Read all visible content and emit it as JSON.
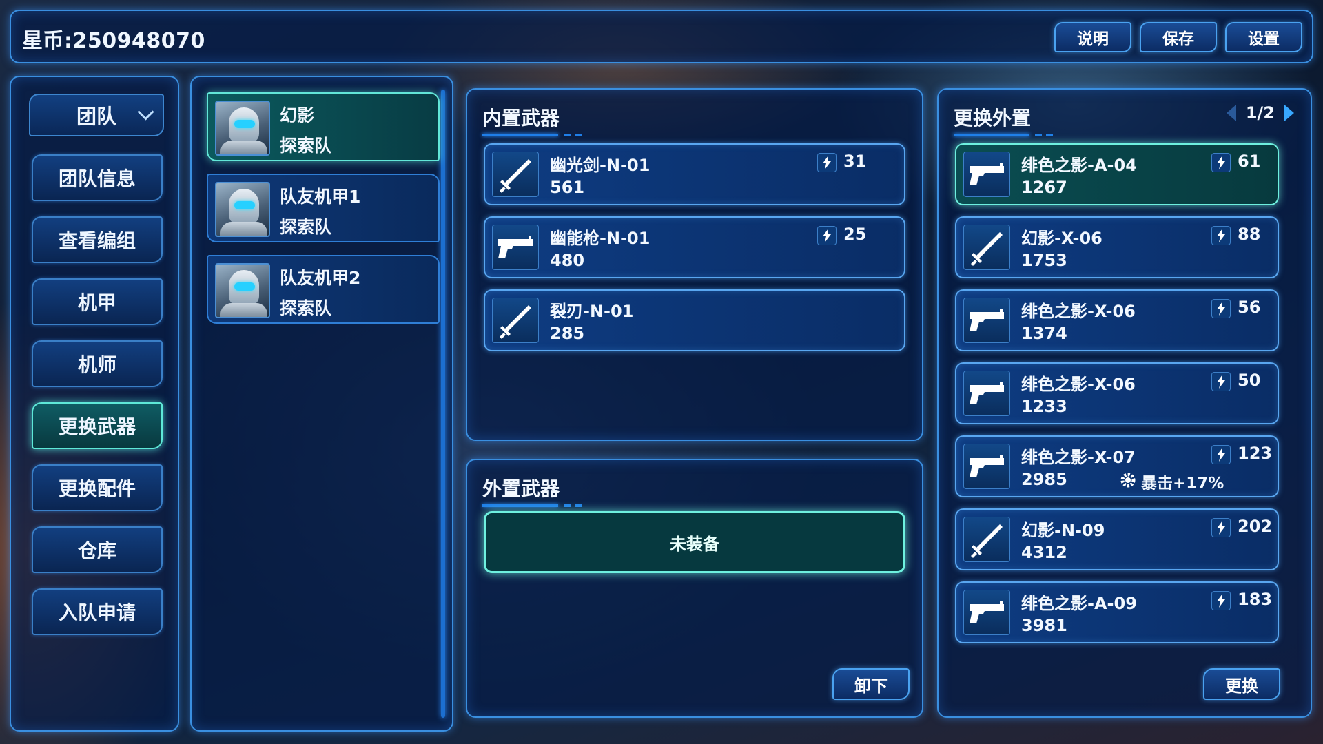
{
  "header": {
    "coins": "星币:250948070",
    "buttons": {
      "help": "说明",
      "save": "保存",
      "settings": "设置"
    }
  },
  "nav": {
    "dropdown": "团队",
    "items": [
      "团队信息",
      "查看编组",
      "机甲",
      "机师",
      "更换武器",
      "更换配件",
      "仓库",
      "入队申请"
    ],
    "active": "更换武器"
  },
  "team": {
    "members": [
      {
        "name": "幻影",
        "team": "探索队",
        "selected": true
      },
      {
        "name": "队友机甲1",
        "team": "探索队",
        "selected": false
      },
      {
        "name": "队友机甲2",
        "team": "探索队",
        "selected": false
      }
    ]
  },
  "internal": {
    "title": "内置武器",
    "weapons": [
      {
        "icon": "sword-icon",
        "name": "幽光剑-N-01",
        "value": "561",
        "energy": "31"
      },
      {
        "icon": "pistol-icon",
        "name": "幽能枪-N-01",
        "value": "480",
        "energy": "25"
      },
      {
        "icon": "sword-icon",
        "name": "裂刃-N-01",
        "value": "285",
        "energy": ""
      }
    ]
  },
  "external": {
    "title": "外置武器",
    "empty_label": "未装备",
    "unequip_button": "卸下"
  },
  "replace": {
    "title": "更换外置",
    "page": "1/2",
    "replace_button": "更换",
    "weapons": [
      {
        "icon": "pistol-icon",
        "name": "绯色之影-A-04",
        "value": "1267",
        "energy": "61",
        "selected": true,
        "bonus": ""
      },
      {
        "icon": "sword-icon",
        "name": "幻影-X-06",
        "value": "1753",
        "energy": "88",
        "selected": false,
        "bonus": ""
      },
      {
        "icon": "pistol-icon",
        "name": "绯色之影-X-06",
        "value": "1374",
        "energy": "56",
        "selected": false,
        "bonus": ""
      },
      {
        "icon": "pistol-icon",
        "name": "绯色之影-X-06",
        "value": "1233",
        "energy": "50",
        "selected": false,
        "bonus": ""
      },
      {
        "icon": "pistol-icon",
        "name": "绯色之影-X-07",
        "value": "2985",
        "energy": "123",
        "selected": false,
        "bonus": "暴击+17%"
      },
      {
        "icon": "sword-icon",
        "name": "幻影-N-09",
        "value": "4312",
        "energy": "202",
        "selected": false,
        "bonus": ""
      },
      {
        "icon": "pistol-icon",
        "name": "绯色之影-A-09",
        "value": "3981",
        "energy": "183",
        "selected": false,
        "bonus": ""
      }
    ]
  },
  "colors": {
    "accent": "#3a8fe0",
    "selected": "#6ef0df",
    "panel_bg": "#0a2d66"
  }
}
